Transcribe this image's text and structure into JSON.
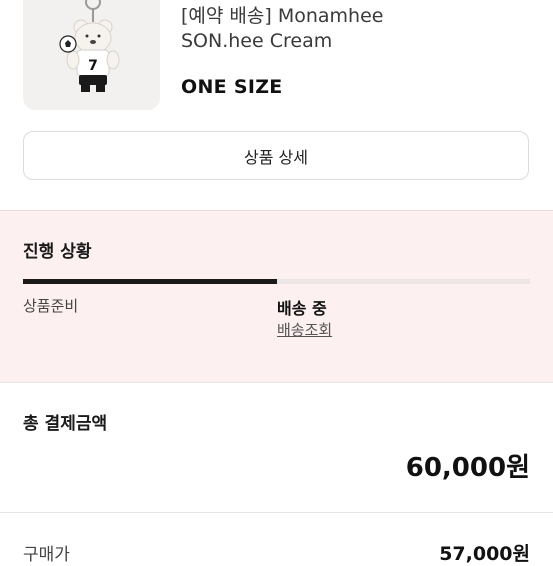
{
  "product": {
    "title_line1": "[예약 배송] Monamhee",
    "title_line2": "SON.hee Cream",
    "option": "ONE SIZE"
  },
  "detail_button": {
    "label": "상품 상세"
  },
  "progress": {
    "title": "진행 상황",
    "fill_fraction": 0.5,
    "steps": [
      {
        "label": "상품준비",
        "active": false
      },
      {
        "label": "배송 중",
        "active": true
      }
    ],
    "tracking_link": "배송조회"
  },
  "payment": {
    "label": "총 결제금액",
    "total": "60,000원"
  },
  "price_row": {
    "label": "구매가",
    "value": "57,000원"
  },
  "colors": {
    "progress_bg": "#fcf1f0",
    "progress_fill": "#1a1a1a",
    "progress_track": "#ece7e6"
  }
}
